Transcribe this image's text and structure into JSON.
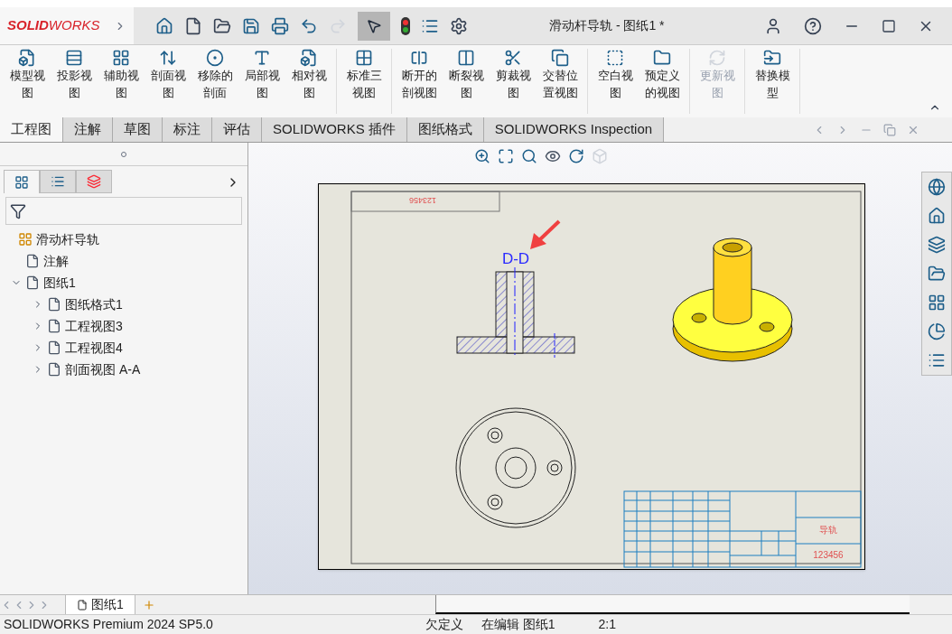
{
  "logo": {
    "strong": "SOLID",
    "light": "WORKS"
  },
  "window": {
    "title": "滑动杆导轨 - 图纸1 *"
  },
  "ribbon": {
    "groups": [
      [
        {
          "label": "模型视图",
          "disabled": false
        },
        {
          "label": "投影视图",
          "disabled": false
        },
        {
          "label": "辅助视图",
          "disabled": false
        },
        {
          "label": "剖面视图",
          "disabled": false
        },
        {
          "label": "移除的剖面",
          "disabled": false
        },
        {
          "label": "局部视图",
          "disabled": false
        },
        {
          "label": "相对视图",
          "disabled": false
        }
      ],
      [
        {
          "label": "标准三视图",
          "disabled": false
        }
      ],
      [
        {
          "label": "断开的剖视图",
          "disabled": false
        },
        {
          "label": "断裂视图",
          "disabled": false
        },
        {
          "label": "剪裁视图",
          "disabled": false
        },
        {
          "label": "交替位置视图",
          "disabled": false
        }
      ],
      [
        {
          "label": "空白视图",
          "disabled": false
        },
        {
          "label": "预定义的视图",
          "disabled": false
        }
      ],
      [
        {
          "label": "更新视图",
          "disabled": true
        }
      ],
      [
        {
          "label": "替换模型",
          "disabled": false
        }
      ]
    ]
  },
  "tabs": [
    {
      "label": "工程图",
      "selected": true
    },
    {
      "label": "注解",
      "selected": false
    },
    {
      "label": "草图",
      "selected": false
    },
    {
      "label": "标注",
      "selected": false
    },
    {
      "label": "评估",
      "selected": false
    },
    {
      "label": "SOLIDWORKS 插件",
      "selected": false
    },
    {
      "label": "图纸格式",
      "selected": false
    },
    {
      "label": "SOLIDWORKS Inspection",
      "selected": false
    }
  ],
  "panel_tabs": [
    {
      "selected": true
    },
    {
      "selected": false
    },
    {
      "selected": false
    }
  ],
  "tree": {
    "label": "滑动杆导轨",
    "children": [
      {
        "label": "注解"
      },
      {
        "label": "图纸1",
        "expanded": true,
        "children": [
          {
            "label": "图纸格式1",
            "expanded": false
          },
          {
            "label": "工程视图3",
            "expanded": false
          },
          {
            "label": "工程视图4",
            "expanded": false
          },
          {
            "label": "剖面视图 A-A",
            "expanded": false
          }
        ]
      }
    ]
  },
  "sheet": {
    "view_label": "D-D",
    "corner_code": "123456",
    "part_name": "导轨",
    "drawing_number": "123456"
  },
  "sheet_tabs": [
    {
      "label": "图纸1",
      "selected": true
    }
  ],
  "status_bar": {
    "product": "SOLIDWORKS Premium 2024 SP5.0",
    "state": "欠定义",
    "mode": "在编辑 图纸1",
    "scale": "2:1"
  }
}
